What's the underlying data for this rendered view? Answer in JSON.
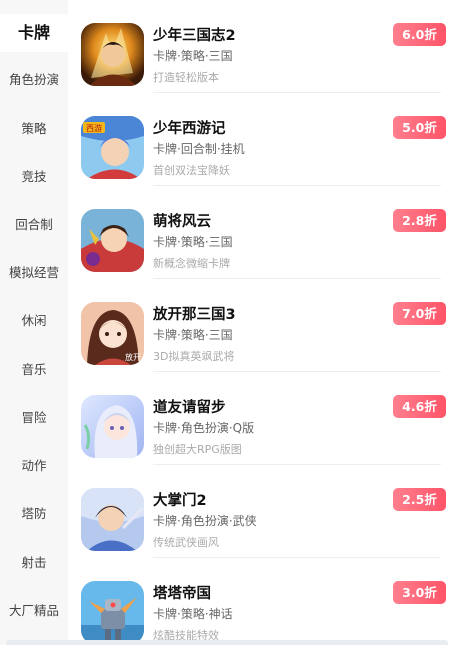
{
  "sidebar": {
    "items": [
      {
        "label": "卡牌"
      },
      {
        "label": "角色扮演"
      },
      {
        "label": "策略"
      },
      {
        "label": "竞技"
      },
      {
        "label": "回合制"
      },
      {
        "label": "模拟经营"
      },
      {
        "label": "休闲"
      },
      {
        "label": "音乐"
      },
      {
        "label": "冒险"
      },
      {
        "label": "动作"
      },
      {
        "label": "塔防"
      },
      {
        "label": "射击"
      },
      {
        "label": "大厂精品"
      }
    ],
    "active_index": 0
  },
  "games": [
    {
      "name": "少年三国志2",
      "tags": "卡牌·策略·三国",
      "desc": "打造轻松版本",
      "discount": "6.0折"
    },
    {
      "name": "少年西游记",
      "tags": "卡牌·回合制·挂机",
      "desc": "首创双法宝降妖",
      "discount": "5.0折"
    },
    {
      "name": "萌将风云",
      "tags": "卡牌·策略·三国",
      "desc": "新概念微缩卡牌",
      "discount": "2.8折"
    },
    {
      "name": "放开那三国3",
      "tags": "卡牌·策略·三国",
      "desc": "3D拟真英飒武将",
      "discount": "7.0折"
    },
    {
      "name": "道友请留步",
      "tags": "卡牌·角色扮演·Q版",
      "desc": "独创超大RPG版图",
      "discount": "4.6折"
    },
    {
      "name": "大掌门2",
      "tags": "卡牌·角色扮演·武侠",
      "desc": "传统武侠画风",
      "discount": "2.5折"
    },
    {
      "name": "塔塔帝国",
      "tags": "卡牌·策略·神话",
      "desc": "炫酷技能特效",
      "discount": "3.0折"
    }
  ],
  "icon_text": {
    "game2": "西游",
    "game4": "放开"
  },
  "colors": {
    "badge_start": "#ff7f8e",
    "badge_end": "#ff5468",
    "sidebar_bg": "#f7f7f7"
  }
}
